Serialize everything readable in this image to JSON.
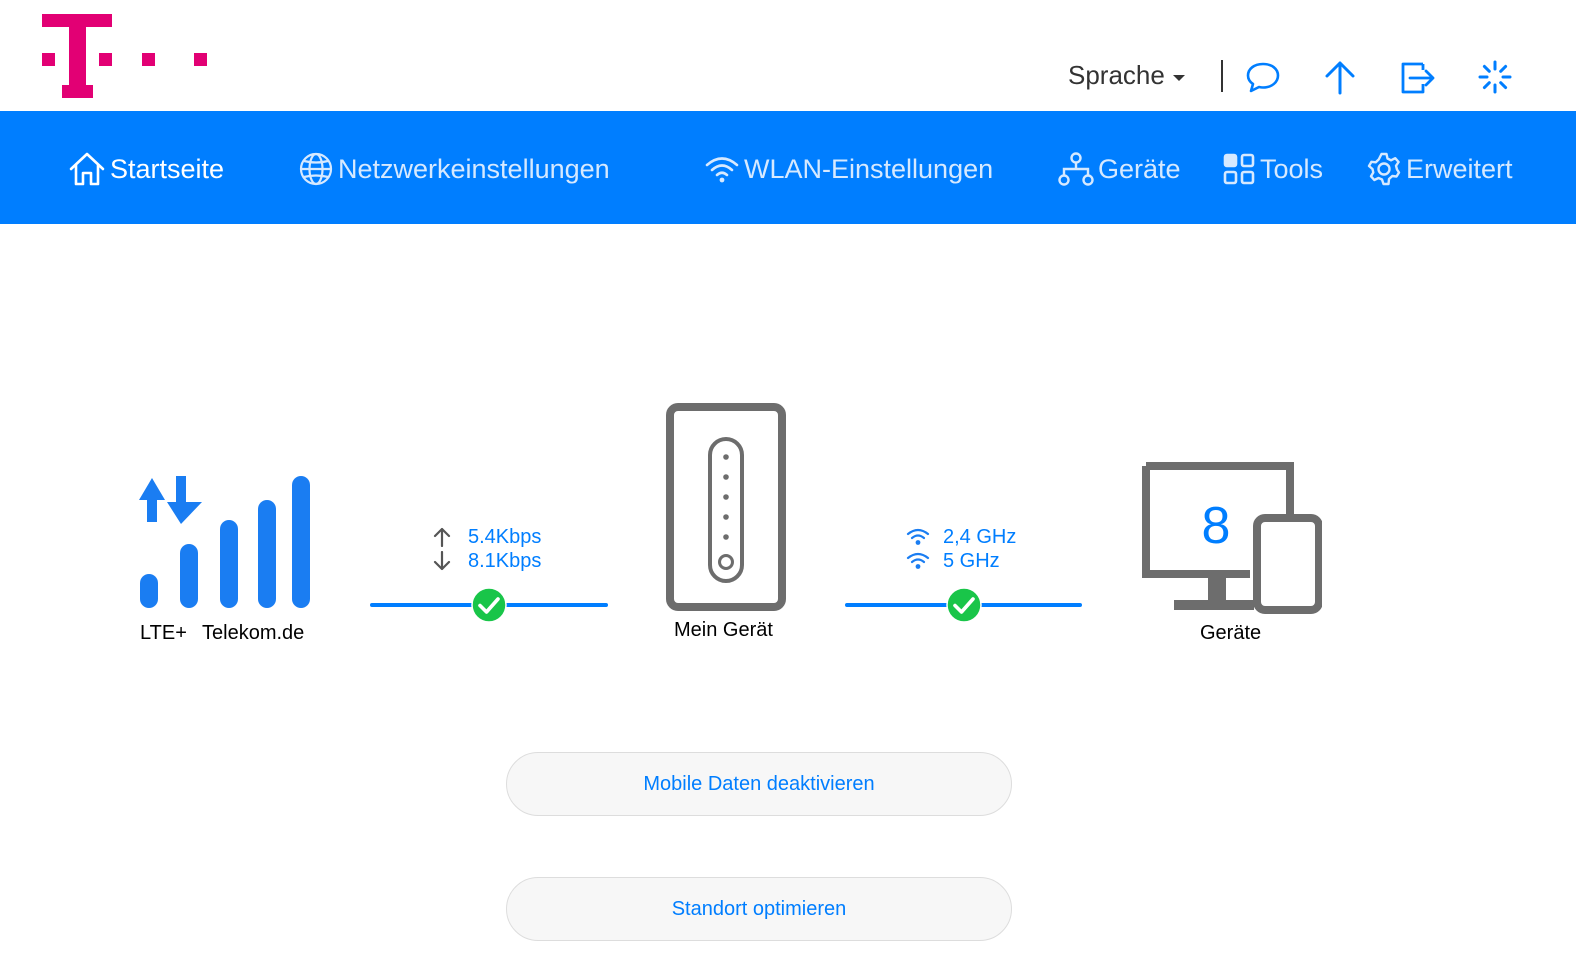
{
  "header": {
    "language_label": "Sprache",
    "icons": [
      "chat-icon",
      "upload-icon",
      "logout-icon",
      "loading-icon"
    ]
  },
  "nav": {
    "items": [
      {
        "label": "Startseite",
        "icon": "home-icon",
        "active": true
      },
      {
        "label": "Netzwerkeinstellungen",
        "icon": "globe-icon",
        "active": false
      },
      {
        "label": "WLAN-Einstellungen",
        "icon": "wifi-icon",
        "active": false
      },
      {
        "label": "Geräte",
        "icon": "network-icon",
        "active": false
      },
      {
        "label": "Tools",
        "icon": "grid-icon",
        "active": false
      },
      {
        "label": "Erweitert",
        "icon": "gear-icon",
        "active": false
      }
    ]
  },
  "status": {
    "network_type": "LTE+",
    "operator": "Telekom.de",
    "upload_speed": "5.4Kbps",
    "download_speed": "8.1Kbps",
    "device_label": "Mein Gerät",
    "wifi_band_1": "2,4 GHz",
    "wifi_band_2": "5 GHz",
    "devices_count": "8",
    "devices_label": "Geräte"
  },
  "actions": {
    "mobile_data_button": "Mobile Daten deaktivieren",
    "location_button": "Standort optimieren"
  },
  "colors": {
    "brand_magenta": "#e20074",
    "nav_blue": "#007eff",
    "ok_green": "#19c549",
    "device_gray": "#6d6d6d"
  }
}
